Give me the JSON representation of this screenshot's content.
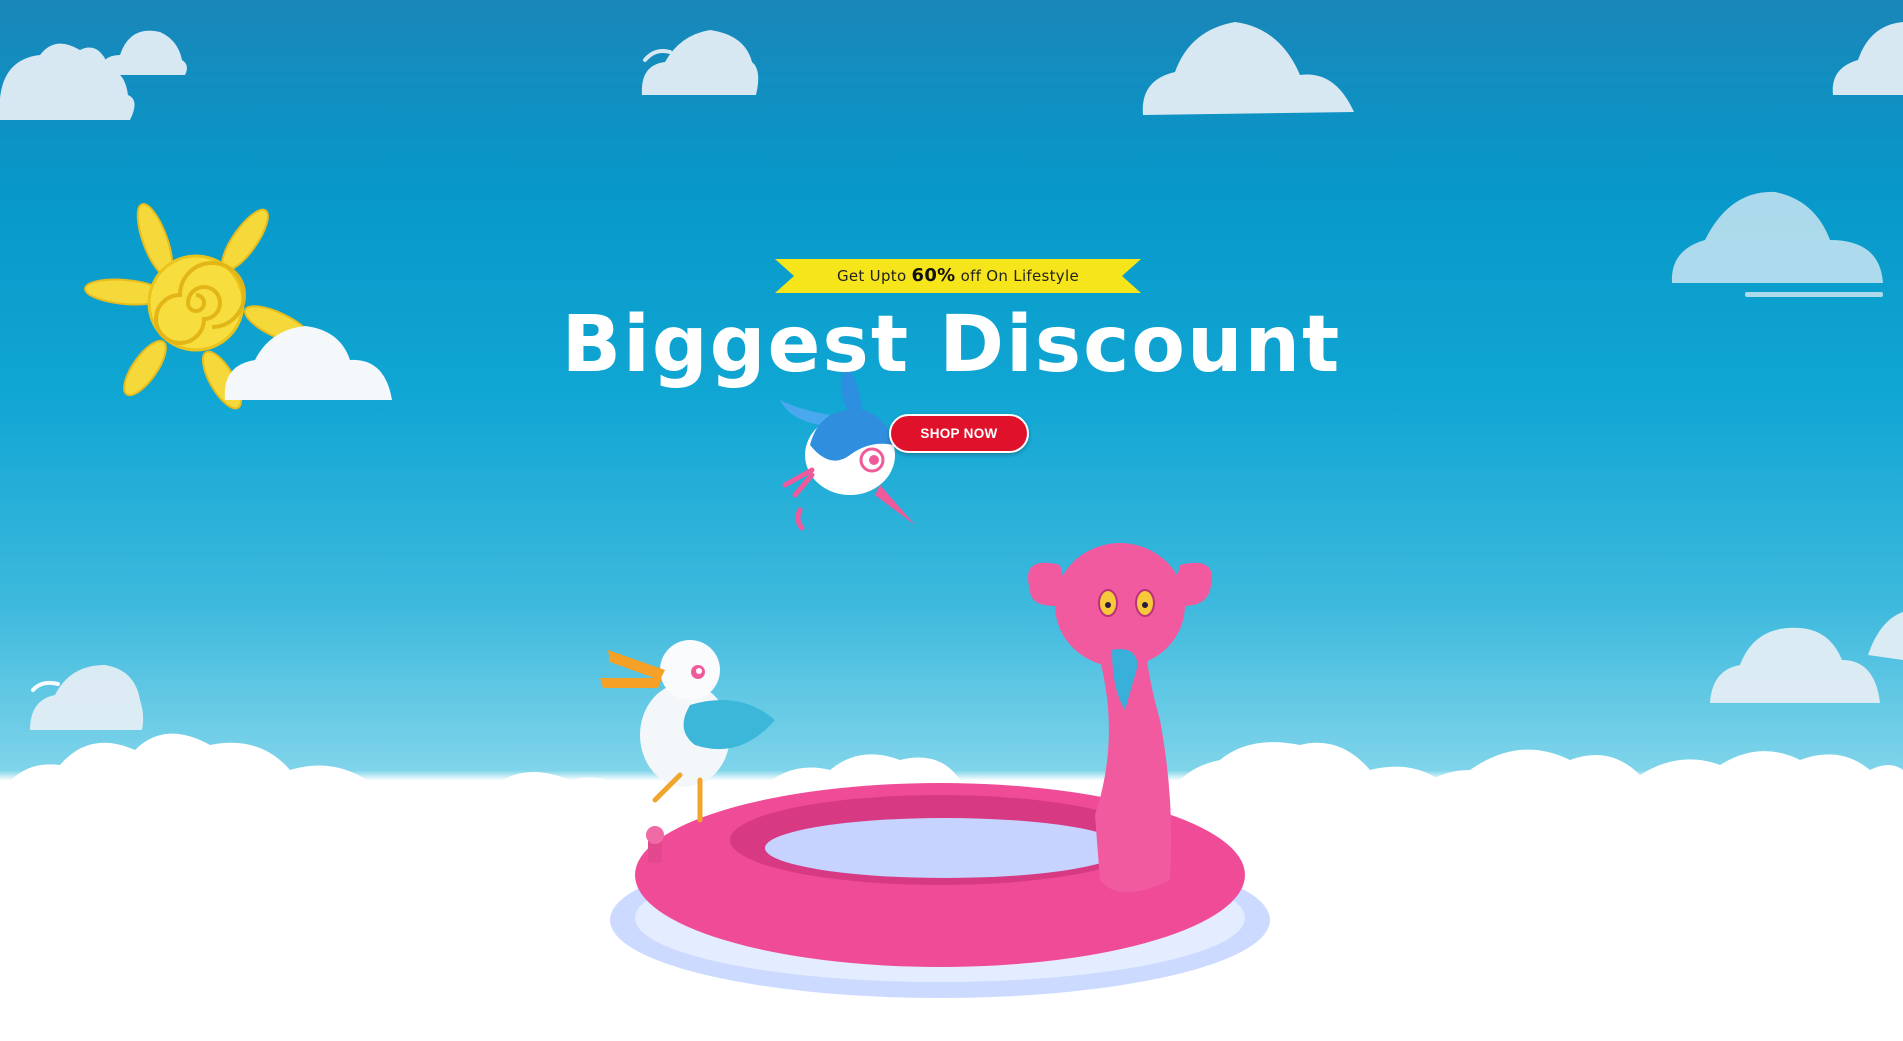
{
  "banner": {
    "promo_prefix": "Get Upto",
    "promo_highlight": "60%",
    "promo_suffix": "off On Lifestyle",
    "headline": "Biggest Discount",
    "cta_label": "SHOP NOW"
  },
  "colors": {
    "sky_top": "#1a86b9",
    "sky_mid": "#10a6d3",
    "sky_bottom": "#7fd4ea",
    "ribbon": "#f7e51b",
    "cta": "#e0112b",
    "flamingo": "#f2539b",
    "sun": "#f5d93a"
  },
  "icons": [
    "sun-icon",
    "cloud-icon",
    "flying-bird-icon",
    "seagull-icon",
    "flamingo-float-icon"
  ]
}
